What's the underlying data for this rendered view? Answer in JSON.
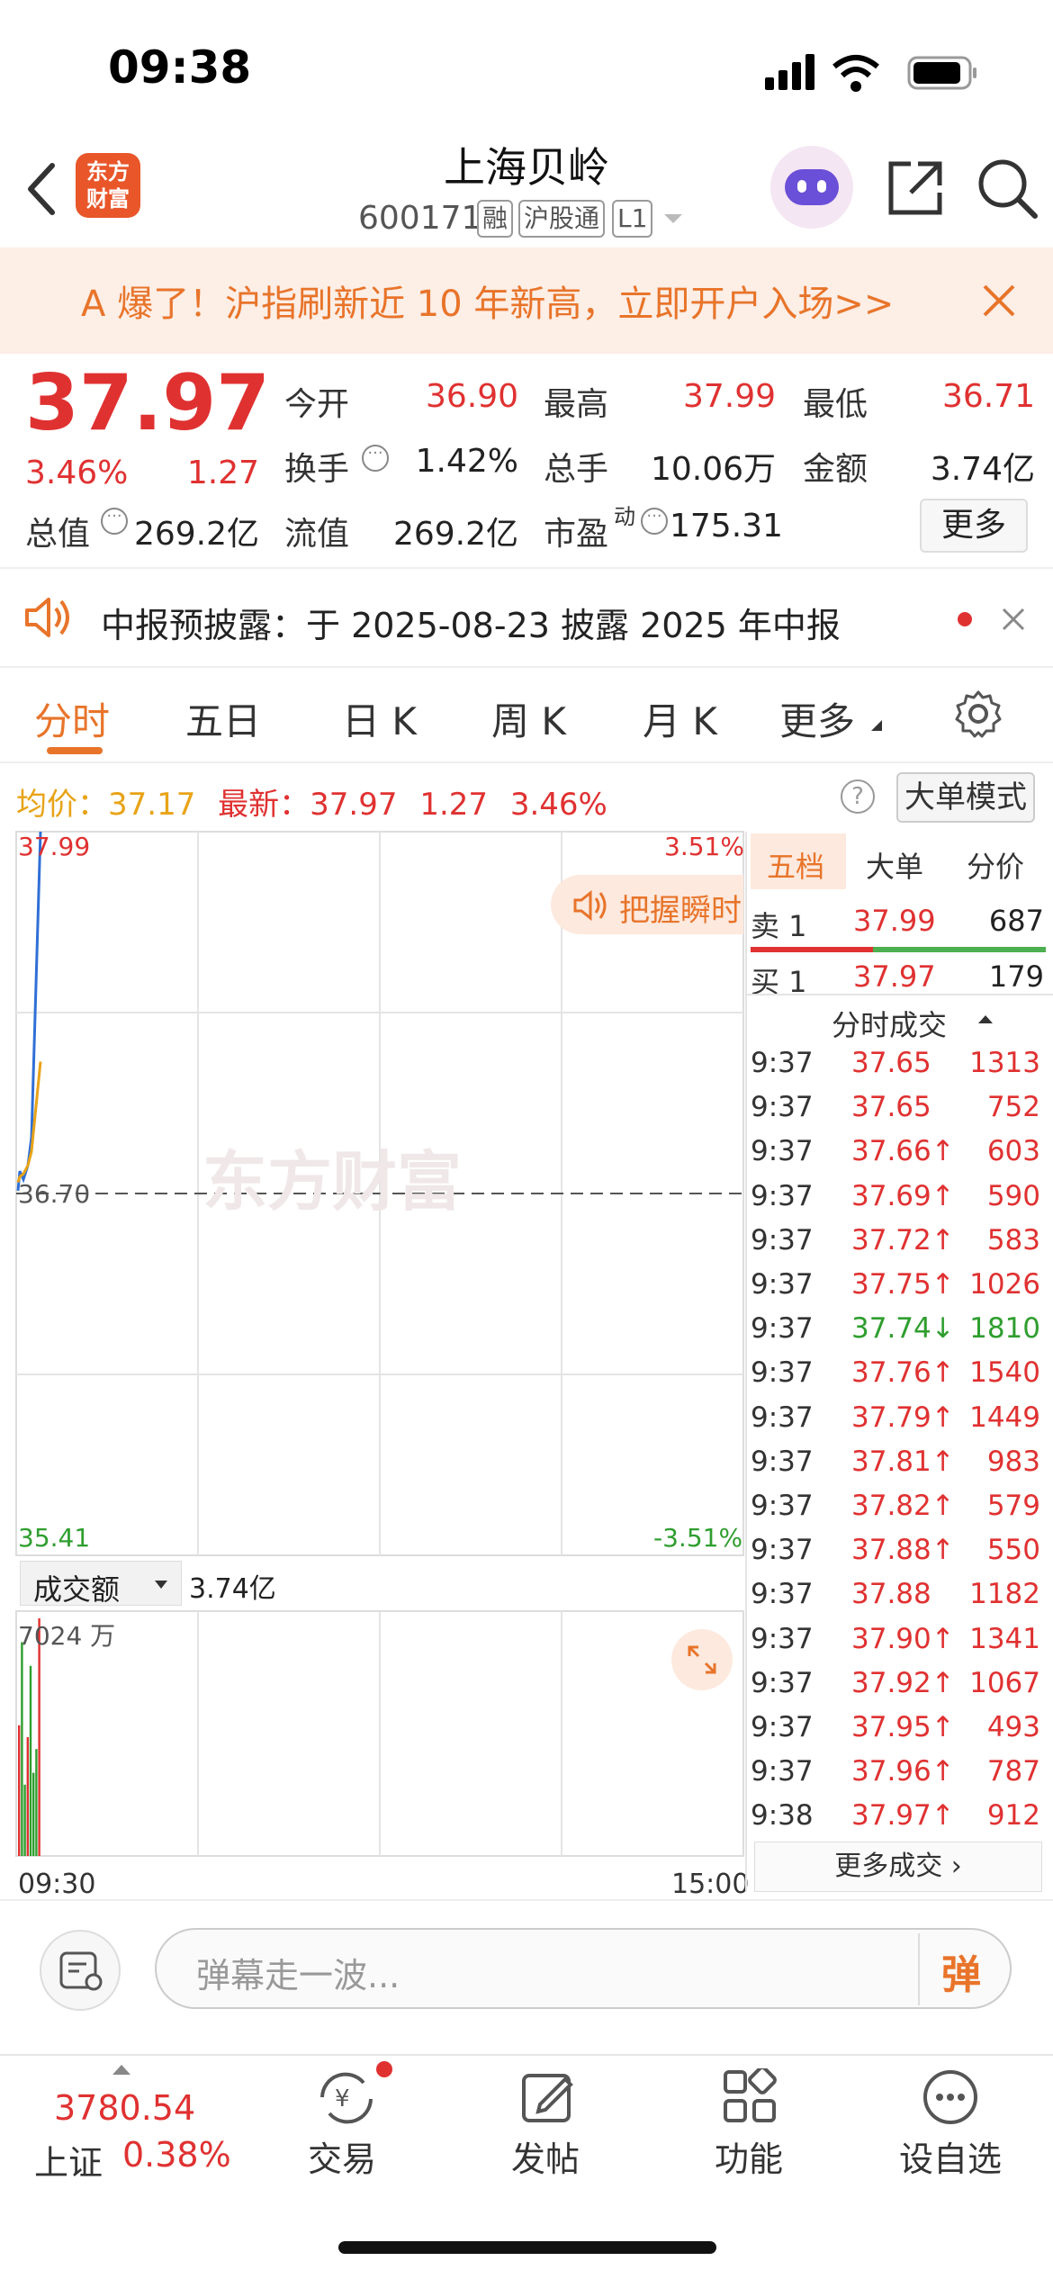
{
  "status_bar": {
    "time": "09:38"
  },
  "header": {
    "logo_text": "东方财富",
    "title": "上海贝岭",
    "code": "600171",
    "tags": [
      "融",
      "沪股通",
      "L1"
    ]
  },
  "banner": {
    "text": "A 爆了！沪指刷新近 10 年新高，立即开户入场>>"
  },
  "quote": {
    "price": "37.97",
    "change_pct": "3.46%",
    "change": "1.27",
    "fields": [
      {
        "label": "今开",
        "value": "36.90",
        "color": "red"
      },
      {
        "label": "最高",
        "value": "37.99",
        "color": "red"
      },
      {
        "label": "最低",
        "value": "36.71",
        "color": "red"
      },
      {
        "label": "换手",
        "value": "1.42%",
        "color": "black"
      },
      {
        "label": "总手",
        "value": "10.06万",
        "color": "black"
      },
      {
        "label": "金额",
        "value": "3.74亿",
        "color": "black"
      },
      {
        "label": "总值",
        "value": "269.2亿",
        "color": "black"
      },
      {
        "label": "流值",
        "value": "269.2亿",
        "color": "black"
      },
      {
        "label": "市盈",
        "value": "175.31",
        "color": "black"
      }
    ],
    "pe_sup": "动",
    "more_button": "更多"
  },
  "notice": {
    "text": "中报预披露：于 2025-08-23 披露 2025 年中报"
  },
  "tabs": [
    "分时",
    "五日",
    "日 K",
    "周 K",
    "月 K",
    "更多"
  ],
  "stats_line": {
    "avg_label": "均价：",
    "avg_value": "37.17",
    "latest_label": "最新：",
    "latest_value": "37.97",
    "change": "1.27",
    "change_pct": "3.46%",
    "mode_button": "大单模式"
  },
  "chart": {
    "y_max": "37.99",
    "y_ref": "36.70",
    "y_min": "35.41",
    "pct_max": "3.51%",
    "pct_min": "-3.51%",
    "watermark": "东方财富",
    "promo": "把握瞬时",
    "volume_selector": "成交额",
    "volume_total": "3.74亿",
    "volume_max": "7024 万",
    "time_start": "09:30",
    "time_end": "15:00"
  },
  "chart_data": {
    "type": "line",
    "series": [
      {
        "name": "最新",
        "values": [
          36.71,
          36.78,
          36.75,
          36.8,
          36.9,
          37.99
        ]
      },
      {
        "name": "均价",
        "values": [
          36.74,
          36.76,
          36.77,
          36.8,
          36.85,
          37.17
        ]
      }
    ],
    "ylim": [
      35.41,
      37.99
    ],
    "reference": 36.7,
    "volume_bars": [
      0.55,
      0.9,
      0.3,
      0.5,
      0.8,
      0.35,
      0.45,
      1.0
    ],
    "colors": {
      "price": "#2f6fd6",
      "avg": "#e8a317",
      "up": "#e03131",
      "down": "#2f9e2f"
    }
  },
  "order_book": {
    "tabs": [
      "五档",
      "大单",
      "分价"
    ],
    "sell1": {
      "label": "卖 1",
      "price": "37.99",
      "volume": "687"
    },
    "buy1": {
      "label": "买 1",
      "price": "37.97",
      "volume": "179"
    },
    "trades_header": "分时成交",
    "trades": [
      {
        "time": "9:37",
        "price": "37.65",
        "volume": "1313",
        "dir": ""
      },
      {
        "time": "9:37",
        "price": "37.65",
        "volume": "752",
        "dir": ""
      },
      {
        "time": "9:37",
        "price": "37.66↑",
        "volume": "603",
        "dir": "up"
      },
      {
        "time": "9:37",
        "price": "37.69↑",
        "volume": "590",
        "dir": "up"
      },
      {
        "time": "9:37",
        "price": "37.72↑",
        "volume": "583",
        "dir": "up"
      },
      {
        "time": "9:37",
        "price": "37.75↑",
        "volume": "1026",
        "dir": "up"
      },
      {
        "time": "9:37",
        "price": "37.74↓",
        "volume": "1810",
        "dir": "down"
      },
      {
        "time": "9:37",
        "price": "37.76↑",
        "volume": "1540",
        "dir": "up"
      },
      {
        "time": "9:37",
        "price": "37.79↑",
        "volume": "1449",
        "dir": "up"
      },
      {
        "time": "9:37",
        "price": "37.81↑",
        "volume": "983",
        "dir": "up"
      },
      {
        "time": "9:37",
        "price": "37.82↑",
        "volume": "579",
        "dir": "up"
      },
      {
        "time": "9:37",
        "price": "37.88↑",
        "volume": "550",
        "dir": "up"
      },
      {
        "time": "9:37",
        "price": "37.88",
        "volume": "1182",
        "dir": ""
      },
      {
        "time": "9:37",
        "price": "37.90↑",
        "volume": "1341",
        "dir": "up"
      },
      {
        "time": "9:37",
        "price": "37.92↑",
        "volume": "1067",
        "dir": "up"
      },
      {
        "time": "9:37",
        "price": "37.95↑",
        "volume": "493",
        "dir": "up"
      },
      {
        "time": "9:37",
        "price": "37.96↑",
        "volume": "787",
        "dir": "up"
      },
      {
        "time": "9:38",
        "price": "37.97↑",
        "volume": "912",
        "dir": "up"
      }
    ],
    "more_trades": "更多成交"
  },
  "danmu": {
    "placeholder": "弹幕走一波...",
    "button": "弹"
  },
  "bottom_nav": {
    "index_value": "3780.54",
    "index_name": "上证",
    "index_pct": "0.38%",
    "items": [
      "交易",
      "发帖",
      "功能",
      "设自选"
    ]
  }
}
